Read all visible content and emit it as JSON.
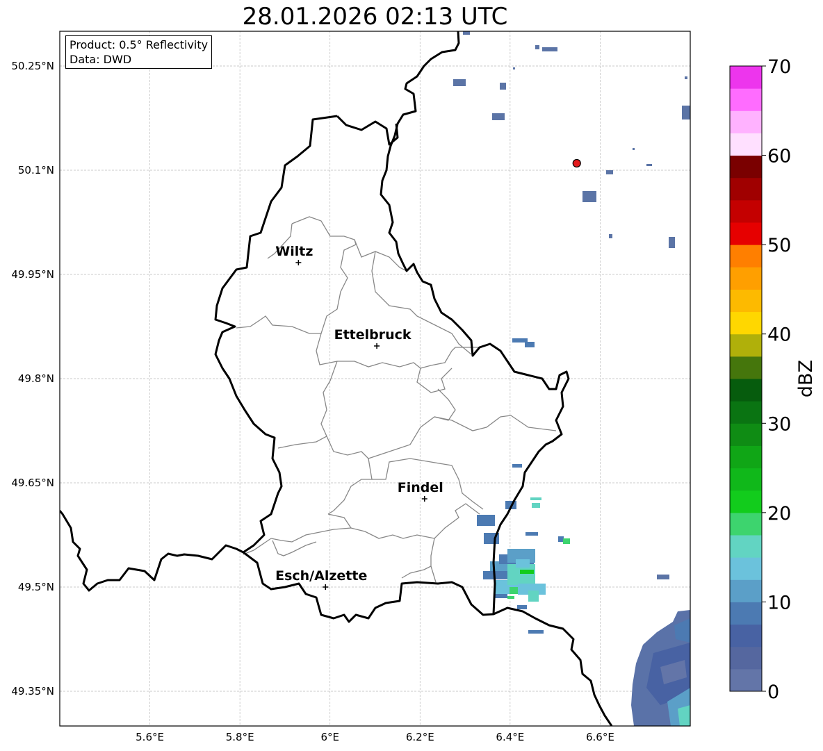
{
  "title": "28.01.2026 02:13 UTC",
  "info": {
    "product": "Product: 0.5° Reflectivity",
    "data": "Data: DWD"
  },
  "map": {
    "lon_range": [
      5.4,
      6.8
    ],
    "lat_range": [
      49.3,
      50.3
    ],
    "lon_ticks": [
      {
        "v": 5.6,
        "label": "5.6°E"
      },
      {
        "v": 5.8,
        "label": "5.8°E"
      },
      {
        "v": 6.0,
        "label": "6°E"
      },
      {
        "v": 6.2,
        "label": "6.2°E"
      },
      {
        "v": 6.4,
        "label": "6.4°E"
      },
      {
        "v": 6.6,
        "label": "6.6°E"
      }
    ],
    "lat_ticks": [
      {
        "v": 50.25,
        "label": "50.25°N"
      },
      {
        "v": 50.1,
        "label": "50.1°N"
      },
      {
        "v": 49.95,
        "label": "49.95°N"
      },
      {
        "v": 49.8,
        "label": "49.8°N"
      },
      {
        "v": 49.65,
        "label": "49.65°N"
      },
      {
        "v": 49.5,
        "label": "49.5°N"
      },
      {
        "v": 49.35,
        "label": "49.35°N"
      }
    ],
    "cities": [
      {
        "name": "Wiltz",
        "lon": 5.93,
        "lat": 49.967
      },
      {
        "name": "Ettelbruck",
        "lon": 6.104,
        "lat": 49.847
      },
      {
        "name": "Findel",
        "lon": 6.21,
        "lat": 49.627
      },
      {
        "name": "Esch/Alzette",
        "lon": 5.99,
        "lat": 49.5
      }
    ],
    "radar_site": {
      "lon": 6.548,
      "lat": 50.11,
      "color": "#e31a1c"
    }
  },
  "colorbar": {
    "label": "dBZ",
    "min": 0,
    "max": 70,
    "ticks": [
      0,
      10,
      20,
      30,
      40,
      50,
      60,
      70
    ],
    "colors": [
      "#6375a8",
      "#55679f",
      "#4862a3",
      "#4c7ab2",
      "#5b9fc8",
      "#6bc2dc",
      "#62d4c2",
      "#3dd46e",
      "#12cc1c",
      "#10b81a",
      "#10a616",
      "#0f8c14",
      "#0a7412",
      "#065c0d",
      "#45760c",
      "#b0b00a",
      "#ffd700",
      "#fdba00",
      "#ff9f00",
      "#ff7f00",
      "#e60000",
      "#c40000",
      "#a00000",
      "#7a0000",
      "#ffe0ff",
      "#ffb2ff",
      "#ff6cff",
      "#ed35ed"
    ]
  }
}
